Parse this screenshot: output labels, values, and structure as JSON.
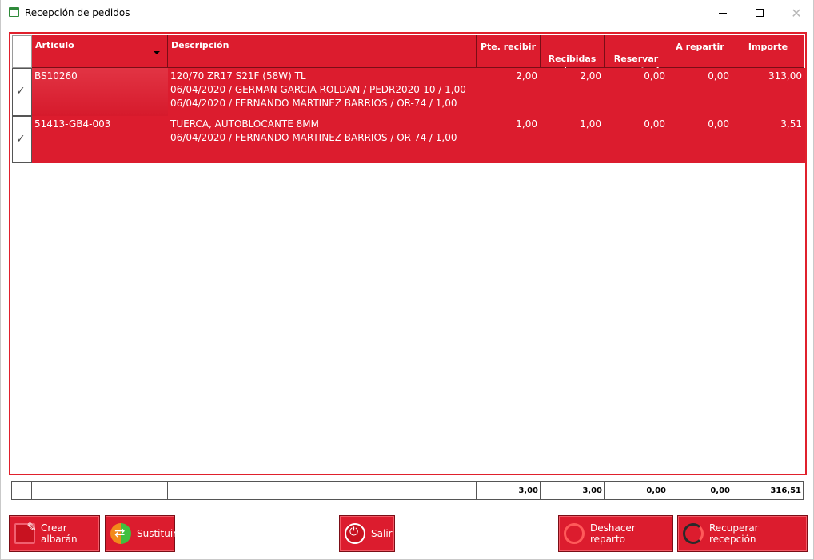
{
  "window": {
    "title": "Recepción de pedidos"
  },
  "grid": {
    "columns": [
      {
        "label": "Articulo"
      },
      {
        "label": "Descripción"
      },
      {
        "label": "Pte. recibir"
      },
      {
        "label": "Recibidas\nahora"
      },
      {
        "label": "Reservar\npara stock"
      },
      {
        "label": "A repartir"
      },
      {
        "label": "Importe"
      }
    ],
    "rows": [
      {
        "checked": "✓",
        "articulo": "BS10260",
        "desc_lines": [
          "120/70 ZR17 S21F (58W) TL",
          "06/04/2020 / GERMAN GARCIA ROLDAN / PEDR2020-10 / 1,00",
          "06/04/2020 / FERNANDO MARTINEZ BARRIOS / OR-74 / 1,00"
        ],
        "pte_recibir": "2,00",
        "recibidas": "2,00",
        "reservar": "0,00",
        "repartir": "0,00",
        "importe": "313,00"
      },
      {
        "checked": "✓",
        "articulo": "51413-GB4-003",
        "desc_lines": [
          "TUERCA, AUTOBLOCANTE 8MM",
          "06/04/2020 / FERNANDO MARTINEZ BARRIOS / OR-74 / 1,00"
        ],
        "pte_recibir": "1,00",
        "recibidas": "1,00",
        "reservar": "0,00",
        "repartir": "0,00",
        "importe": "3,51"
      }
    ]
  },
  "totals": {
    "pte_recibir": "3,00",
    "recibidas": "3,00",
    "reservar": "0,00",
    "repartir": "0,00",
    "importe": "316,51"
  },
  "buttons": {
    "crear": "Crear albarán",
    "sustituir": "Sustituir",
    "salir_first": "S",
    "salir_rest": "alir",
    "deshacer": "Deshacer reparto",
    "recuperar": "Recuperar recepción"
  }
}
